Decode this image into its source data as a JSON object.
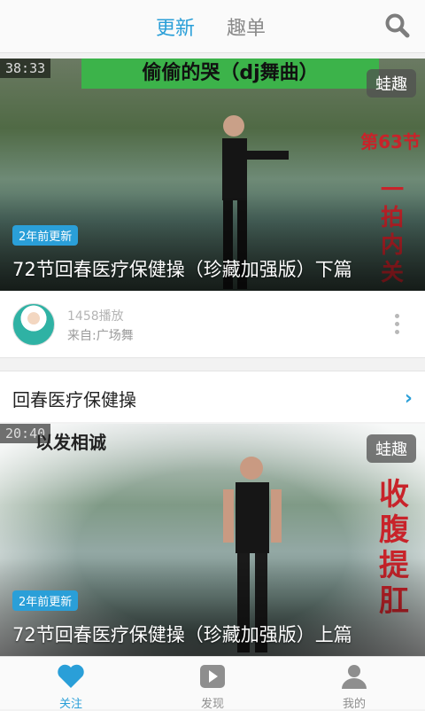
{
  "header": {
    "tabs": [
      {
        "label": "更新",
        "active": true
      },
      {
        "label": "趣单",
        "active": false
      }
    ],
    "search_icon": "search-icon"
  },
  "colors": {
    "accent": "#2a9fd8",
    "inactive": "#8a8a8a",
    "banner_green": "#3cb34a",
    "caption_red": "#c8232a"
  },
  "videos": [
    {
      "duration": "38:33",
      "banner": "偷偷的哭（dj舞曲）",
      "badge": "蛙趣",
      "side_caption_top": "第63节",
      "side_caption": "一拍内关",
      "age": "2年前更新",
      "title": "72节回春医疗保健操（珍藏加强版）下篇"
    },
    {
      "duration": "20:40",
      "banner": "以发相诚",
      "badge": "蛙趣",
      "side_caption": "收腹提肛",
      "age": "2年前更新",
      "title": "72节回春医疗保健操（珍藏加强版）上篇"
    }
  ],
  "meta": {
    "plays": "1458播放",
    "source": "来自:广场舞"
  },
  "playlist": {
    "title": "回春医疗保健操"
  },
  "nav": [
    {
      "label": "关注",
      "icon": "heart-icon",
      "active": true
    },
    {
      "label": "发现",
      "icon": "play-icon",
      "active": false
    },
    {
      "label": "我的",
      "icon": "user-icon",
      "active": false
    }
  ]
}
